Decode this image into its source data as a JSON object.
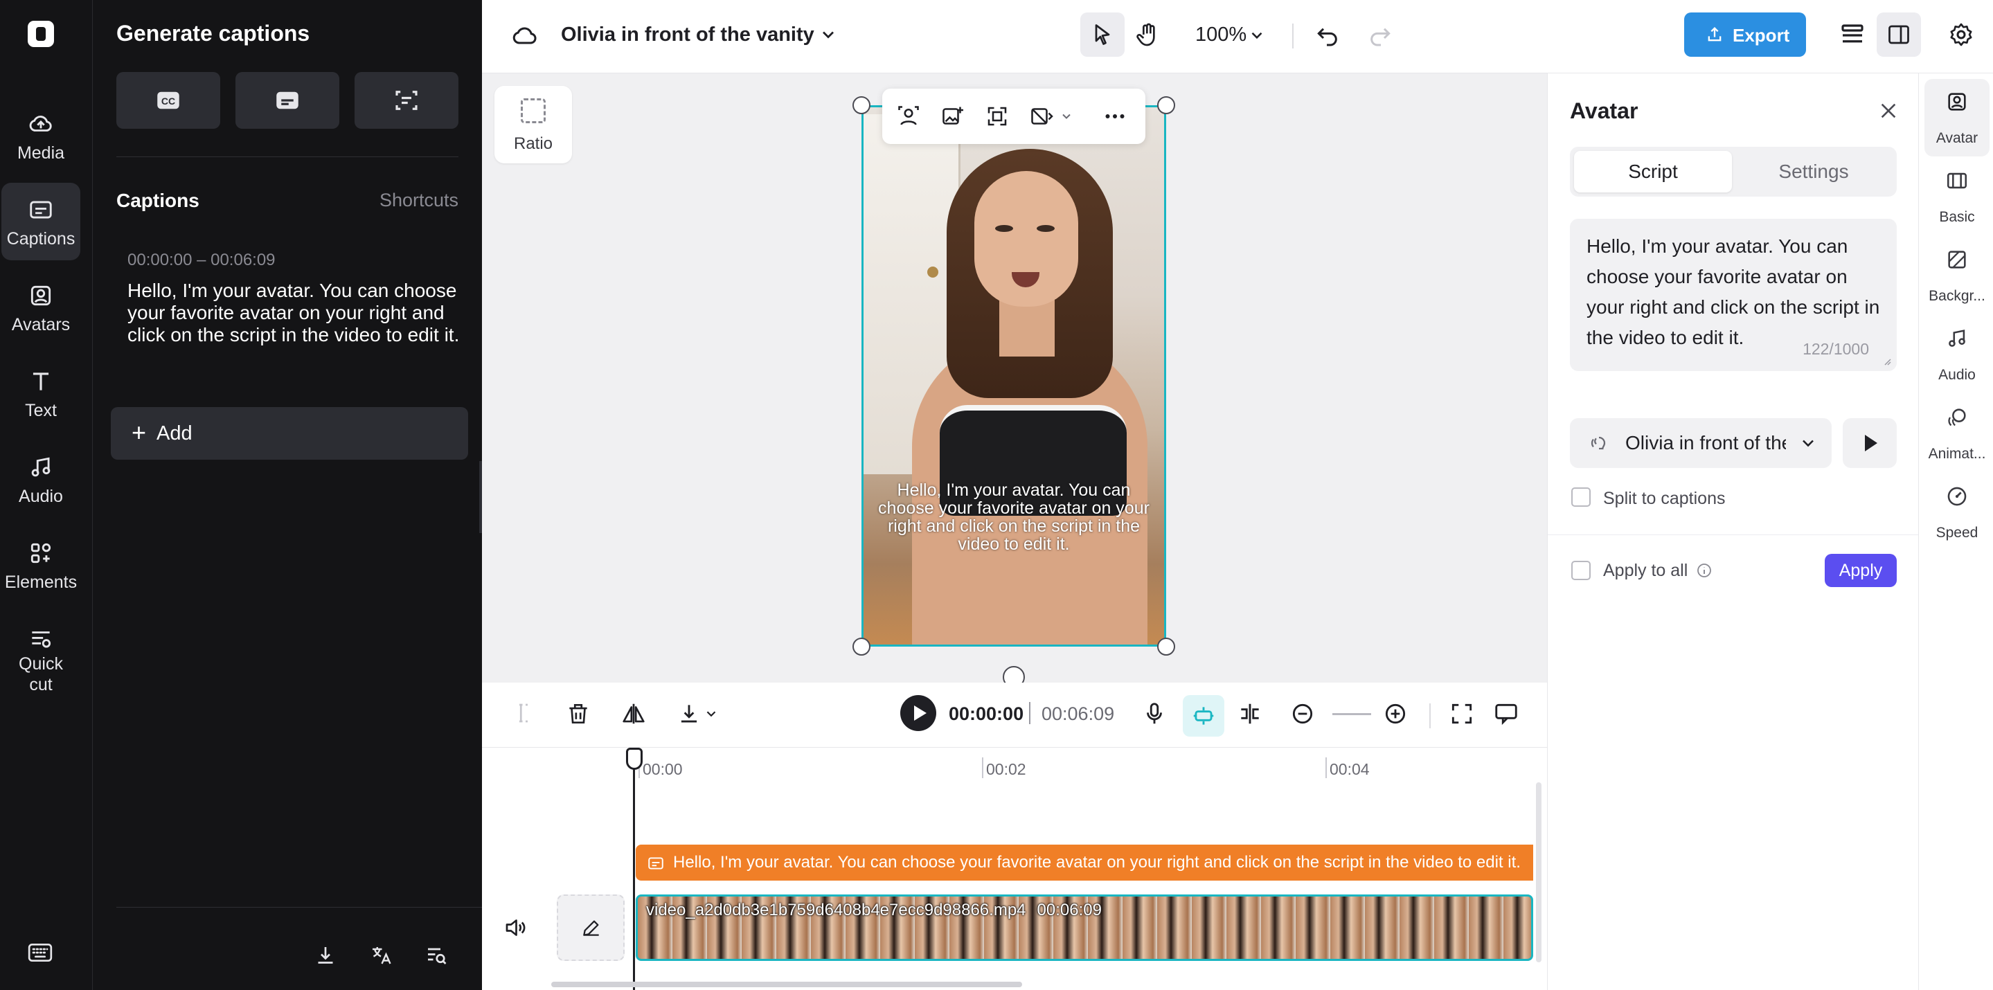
{
  "left_nav": {
    "items": [
      {
        "label": "Media",
        "icon": "cloud-upload-icon"
      },
      {
        "label": "Captions",
        "icon": "captions-icon"
      },
      {
        "label": "Avatars",
        "icon": "avatar-icon"
      },
      {
        "label": "Text",
        "icon": "text-icon"
      },
      {
        "label": "Audio",
        "icon": "music-note-icon"
      },
      {
        "label": "Elements",
        "icon": "elements-icon"
      },
      {
        "label": "Quick cut",
        "icon": "quick-cut-icon"
      }
    ],
    "active": "Captions"
  },
  "captions_panel": {
    "title": "Generate captions",
    "section_title": "Captions",
    "shortcuts_label": "Shortcuts",
    "caption_entry": {
      "time_range": "00:00:00 – 00:06:09",
      "text": "Hello, I'm your avatar. You can choose your favorite avatar on your right and click on the script in the video to edit it."
    },
    "add_label": "Add"
  },
  "topbar": {
    "project_name": "Olivia in front of the vanity",
    "zoom": "100%",
    "export_label": "Export"
  },
  "canvas": {
    "ratio_label": "Ratio",
    "subtitle_overlay": "Hello, I'm your avatar. You can choose your favorite avatar on your right and click on the script in the video to edit it."
  },
  "playback": {
    "current_time": "00:00:00",
    "duration": "00:06:09"
  },
  "timeline": {
    "ruler_ticks": [
      "00:00",
      "00:02",
      "00:04"
    ],
    "caption_track_text": "Hello, I'm your avatar. You can choose your favorite avatar on your right and click on the script in the video to edit it.",
    "video_clip": {
      "filename": "video_a2d0db3e1b759d6408b4e7ecc9d98866.mp4",
      "duration": "00:06:09"
    }
  },
  "avatar_panel": {
    "title": "Avatar",
    "tabs": [
      "Script",
      "Settings"
    ],
    "active_tab": "Script",
    "script_text": "Hello, I'm your avatar. You can choose your favorite avatar on your right and click on the script in the video to edit it.",
    "char_count": "122/1000",
    "voice": "Olivia in front of the vanity",
    "split_to_captions_label": "Split to captions",
    "apply_to_all_label": "Apply to all",
    "apply_label": "Apply"
  },
  "right_rail": {
    "items": [
      {
        "label": "Avatar",
        "icon": "avatar-icon"
      },
      {
        "label": "Basic",
        "icon": "basic-icon"
      },
      {
        "label": "Backgr...",
        "icon": "background-icon"
      },
      {
        "label": "Audio",
        "icon": "music-note-icon"
      },
      {
        "label": "Animat...",
        "icon": "animation-icon"
      },
      {
        "label": "Speed",
        "icon": "speed-icon"
      }
    ],
    "active": "Avatar"
  },
  "colors": {
    "accent_export": "#2b8fe1",
    "apply_button": "#5b4ef0",
    "selection_cyan": "#19b6c2",
    "caption_track": "#f07f27"
  }
}
